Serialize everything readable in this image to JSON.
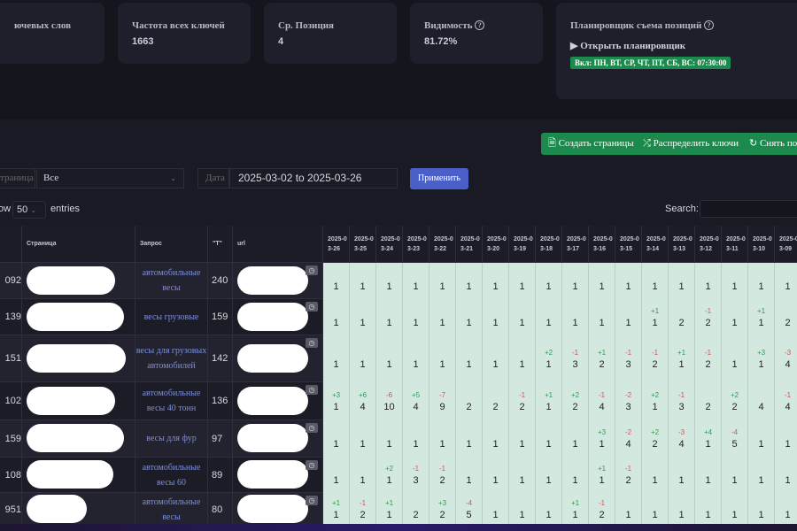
{
  "stats": [
    {
      "label": "ючевых слов",
      "value": ""
    },
    {
      "label": "Частота всех ключей",
      "value": "1663"
    },
    {
      "label": "Ср. Позиция",
      "value": "4"
    },
    {
      "label": "Видимость",
      "value": "81.72%"
    }
  ],
  "scheduler": {
    "title": "Планировщик съема позиций",
    "toggle": "▶ Открыть планировщик",
    "badge": "Вкл: ПН, ВТ, СР, ЧТ, ПТ, СБ, ВС: 07:30:00"
  },
  "actions": {
    "create": "Создать страницы",
    "distribute": "Распределить ключи",
    "take": "Снять поз"
  },
  "filters": {
    "page_label": "траница",
    "page_value": "Все",
    "date_label": "Дата",
    "date_value": "2025-03-02 to 2025-03-26",
    "apply": "Применить"
  },
  "table_ctrl": {
    "show": "ow",
    "entries_value": "50",
    "entries": "entries",
    "search": "Search:"
  },
  "headers": {
    "page": "Страница",
    "query": "Запрос",
    "freq": "\"Т\"",
    "url": "url"
  },
  "dates": [
    "2025-03-26",
    "2025-03-25",
    "2025-03-24",
    "2025-03-23",
    "2025-03-22",
    "2025-03-21",
    "2025-03-20",
    "2025-03-19",
    "2025-03-18",
    "2025-03-17",
    "2025-03-16",
    "2025-03-15",
    "2025-03-14",
    "2025-03-13",
    "2025-03-12",
    "2025-03-11",
    "2025-03-10",
    "2025-03-09"
  ],
  "rows": [
    {
      "id": "092",
      "query": "автомобильные весы",
      "freq": "240",
      "pos": [
        "1",
        "1",
        "1",
        "1",
        "1",
        "1",
        "1",
        "1",
        "1",
        "1",
        "1",
        "1",
        "1",
        "1",
        "1",
        "1",
        "1",
        "1"
      ],
      "delta": [
        "",
        "",
        "",
        "",
        "",
        "",
        "",
        "",
        "",
        "",
        "",
        "",
        "",
        "",
        "",
        "",
        "",
        ""
      ]
    },
    {
      "id": "139",
      "query": "весы грузовые",
      "freq": "159",
      "pos": [
        "1",
        "1",
        "1",
        "1",
        "1",
        "1",
        "1",
        "1",
        "1",
        "1",
        "1",
        "1",
        "1",
        "2",
        "2",
        "1",
        "1",
        "2"
      ],
      "delta": [
        "",
        "",
        "",
        "",
        "",
        "",
        "",
        "",
        "",
        "",
        "",
        "",
        "+1",
        "",
        "-1",
        "",
        "+1",
        ""
      ]
    },
    {
      "id": "151",
      "query": "весы для грузовых автомобилей",
      "freq": "142",
      "pos": [
        "1",
        "1",
        "1",
        "1",
        "1",
        "1",
        "1",
        "1",
        "1",
        "3",
        "2",
        "3",
        "2",
        "1",
        "2",
        "1",
        "1",
        "4"
      ],
      "delta": [
        "",
        "",
        "",
        "",
        "",
        "",
        "",
        "",
        "+2",
        "-1",
        "+1",
        "-1",
        "-1",
        "+1",
        "-1",
        "",
        "+3",
        "-3"
      ]
    },
    {
      "id": "102",
      "query": "автомобильные весы 40 тонн",
      "freq": "136",
      "pos": [
        "1",
        "4",
        "10",
        "4",
        "9",
        "2",
        "2",
        "2",
        "1",
        "2",
        "4",
        "3",
        "1",
        "3",
        "2",
        "2",
        "4",
        "4"
      ],
      "delta": [
        "+3",
        "+6",
        "-6",
        "+5",
        "-7",
        "",
        "",
        "-1",
        "+1",
        "+2",
        "-1",
        "-2",
        "+2",
        "-1",
        "",
        "+2",
        "",
        "-1"
      ]
    },
    {
      "id": "159",
      "query": "весы для фур",
      "freq": "97",
      "pos": [
        "1",
        "1",
        "1",
        "1",
        "1",
        "1",
        "1",
        "1",
        "1",
        "1",
        "1",
        "4",
        "2",
        "4",
        "1",
        "5",
        "1",
        "1"
      ],
      "delta": [
        "",
        "",
        "",
        "",
        "",
        "",
        "",
        "",
        "",
        "",
        "+3",
        "-2",
        "+2",
        "-3",
        "+4",
        "-4",
        "",
        ""
      ]
    },
    {
      "id": "108",
      "query": "автомобильные весы 60",
      "freq": "89",
      "pos": [
        "1",
        "1",
        "1",
        "3",
        "2",
        "1",
        "1",
        "1",
        "1",
        "1",
        "1",
        "2",
        "1",
        "1",
        "1",
        "1",
        "1",
        "1"
      ],
      "delta": [
        "",
        "",
        "+2",
        "-1",
        "-1",
        "",
        "",
        "",
        "",
        "",
        "+1",
        "-1",
        "",
        "",
        "",
        "",
        "",
        ""
      ]
    },
    {
      "id": "951",
      "query": "автомобильные весы",
      "freq": "80",
      "pos": [
        "1",
        "2",
        "1",
        "2",
        "2",
        "5",
        "1",
        "1",
        "1",
        "1",
        "2",
        "1",
        "1",
        "1",
        "1",
        "1",
        "1",
        "1"
      ],
      "delta": [
        "+1",
        "-1",
        "+1",
        "",
        "+3",
        "-4",
        "",
        "",
        "",
        "+1",
        "-1",
        "",
        "",
        "",
        "",
        "",
        "",
        ""
      ]
    }
  ]
}
